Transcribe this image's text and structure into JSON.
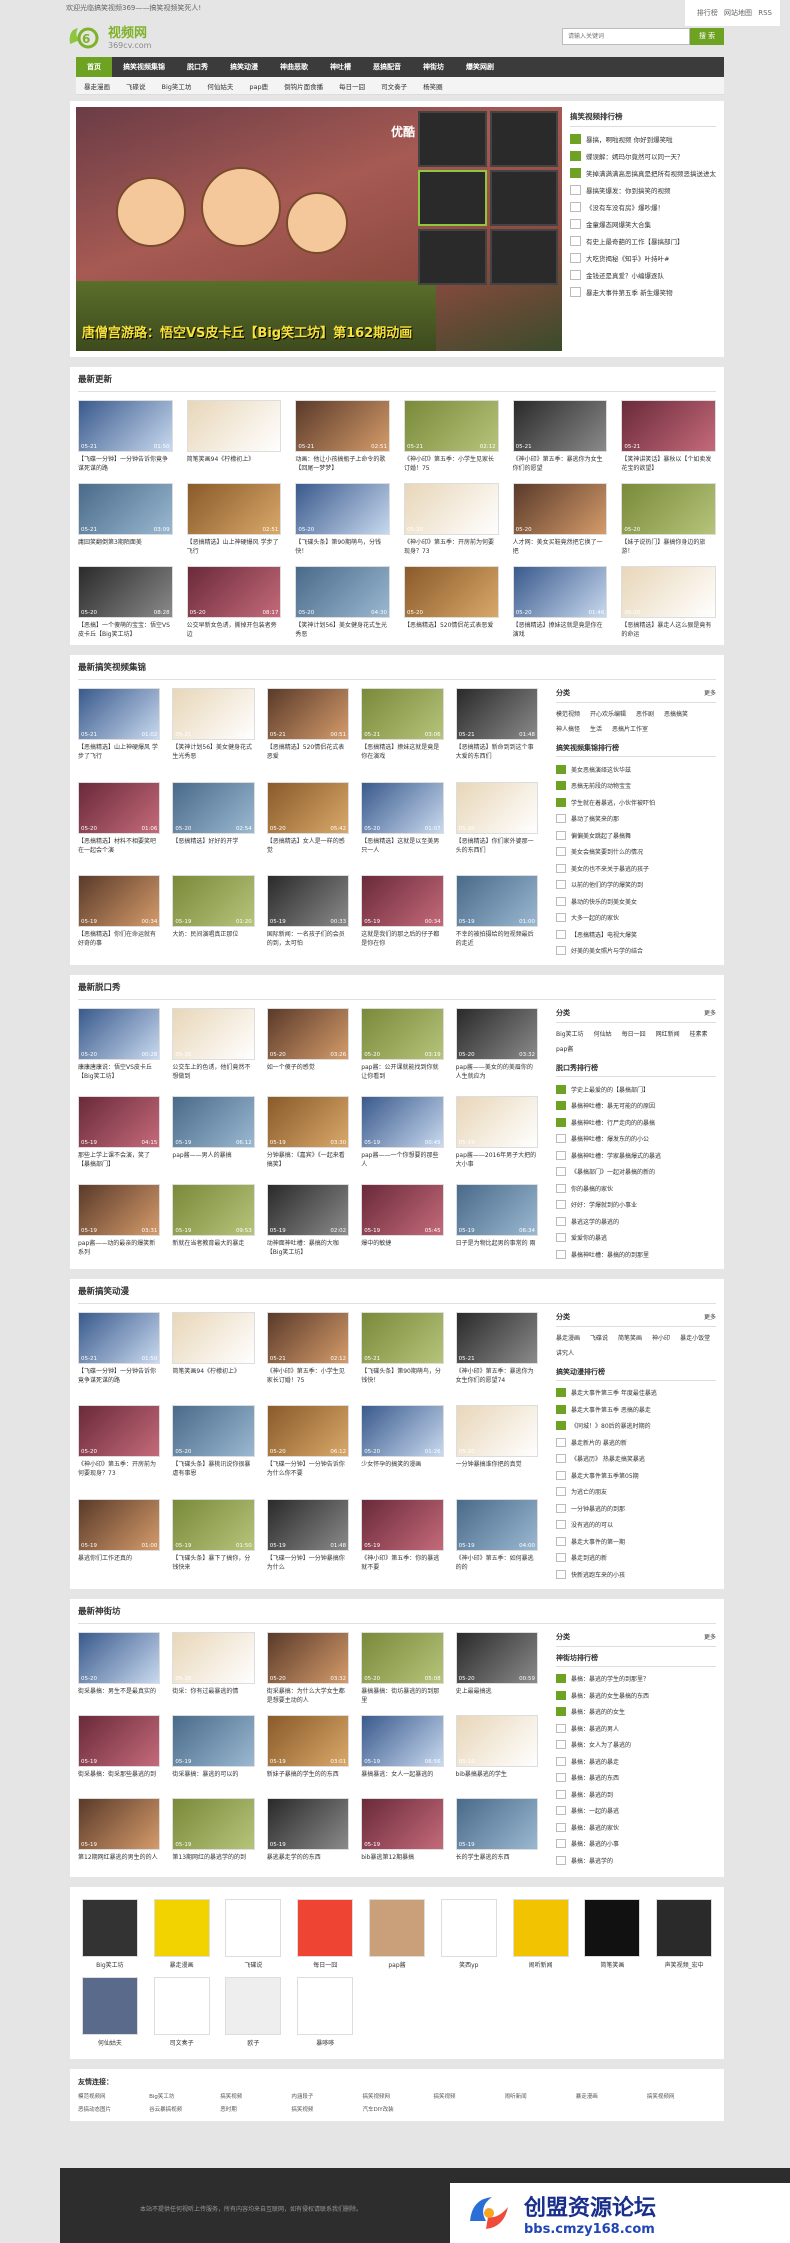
{
  "top": {
    "left": "欢迎光临搞笑视频369——搞笑视频笑死人!",
    "links": [
      "排行榜",
      "网站地图",
      "RSS"
    ]
  },
  "logo": {
    "t1": "视频网",
    "t2": "369cv.com"
  },
  "search": {
    "placeholder": "请输入关键词",
    "button": "搜 索"
  },
  "nav": [
    "首页",
    "搞笑视频集锦",
    "脱口秀",
    "搞笑动漫",
    "神曲恶歌",
    "神吐槽",
    "恶搞配音",
    "神街坊",
    "爆笑网剧"
  ],
  "subnav": [
    "暴走漫画",
    "飞碟说",
    "Big笑工坊",
    "何仙姑夫",
    "pap鹿",
    "倒钩片面食播",
    "每日一囧",
    "司文奏子",
    "杨笑圈"
  ],
  "banner": {
    "brand": "优酷",
    "caption": "唐僧宫游路：悟空VS皮卡丘【Big笑工坊】第162期动画"
  },
  "rank": {
    "title": "搞笑视频排行榜",
    "items": [
      "暴搞，啊啦视频 你好到爆笑啦",
      "蝶误解：嫣玛尔竟然可以同一天？",
      "笑掉满满满高恶搞真是把所有视频恶搞送进太",
      "暴搞笑爆发：你到搞笑的视频",
      "《没有车没有房》爆吵爆！",
      "金童爆态网爆笑大合集",
      "有史上最奇葩的工作【暴搞部门】",
      "大吃货揭秘《知乎》叶持叶#",
      "金钱还是真爱？小编爆逐队",
      "暴走大事件第五季 新生爆笑物"
    ]
  },
  "latest": {
    "title": "最新更新",
    "items": [
      {
        "cap": "【飞碟一分钟】一分钟告诉你竟争谋死谋的路",
        "t": "05-21",
        "d": "01:50"
      },
      {
        "cap": "简笔笑画94《柠檬初上》",
        "t": "",
        "d": ""
      },
      {
        "cap": "动画：他让小孩搞瓶子上命令的歌【回尾一梦梦】",
        "t": "05-21",
        "d": "02:51"
      },
      {
        "cap": "《神小印》第五季：小学生见家长订婚！75",
        "t": "05-21",
        "d": "02:12"
      },
      {
        "cap": "《神小印》第五季：暴逃你为女生你们的愿望",
        "t": "05-21",
        "d": ""
      },
      {
        "cap": "【笑神讲笑话】暴秋以【个如卖发花宝的欲望】",
        "t": "05-21",
        "d": ""
      },
      {
        "cap": "庸囧笑翻倒第3期陌面美",
        "t": "05-21",
        "d": "03:09"
      },
      {
        "cap": "【恶搞精选】山上神硬爆风 学步了飞行",
        "t": "",
        "d": "02:51"
      },
      {
        "cap": "【飞碟头条】第90期萌鸟，分钱快！",
        "t": "05-20",
        "d": ""
      },
      {
        "cap": "《神小印》第五季：开房前为何要现身？73",
        "t": "05-20",
        "d": ""
      },
      {
        "cap": "人才网：美女买鞋竟然把它换了一把",
        "t": "05-20",
        "d": ""
      },
      {
        "cap": "【妹子说热门】暴搞你身边的旅游！",
        "t": "05-20",
        "d": ""
      },
      {
        "cap": "【恶搞】一个傻萌的宝宝：悟空VS皮卡丘【Big笑工坊】",
        "t": "05-20",
        "d": "08:28"
      },
      {
        "cap": "公交早新女色诱，撕掉开包装者旁边",
        "t": "05-20",
        "d": "08:17"
      },
      {
        "cap": "【笑神计划56】美女健身花式生光秀恶",
        "t": "05-20",
        "d": "04:30"
      },
      {
        "cap": "【恶搞精选】520情侣花式表恶爱",
        "t": "05-20",
        "d": ""
      },
      {
        "cap": "【恶搞精选】撩妹这就是竟是你在演戏",
        "t": "05-20",
        "d": "01:46"
      },
      {
        "cap": "【恶搞精选】暴走人这么狠是竟有的命运",
        "t": "05-20",
        "d": "01:03"
      }
    ]
  },
  "collection": {
    "title": "最新搞笑视频集锦",
    "items": [
      {
        "cap": "【恶搞精选】山上神硬爆风 学步了飞行",
        "t": "05-21",
        "d": "01:02"
      },
      {
        "cap": "【笑神计划56】美女健身花式生光秀恶",
        "t": "05-21",
        "d": "04:10"
      },
      {
        "cap": "【恶搞精选】520情侣花式表恶爱",
        "t": "05-21",
        "d": "00:51"
      },
      {
        "cap": "【恶搞精选】撩妹这就是竟是你在演戏",
        "t": "05-21",
        "d": "03:06"
      },
      {
        "cap": "【恶搞精选】新命到到这个事大爱的东西们",
        "t": "05-21",
        "d": "01:48"
      },
      {
        "cap": "【恶搞精选】材料不相要笑吧在一起会个演",
        "t": "05-20",
        "d": "01:06"
      },
      {
        "cap": "【恶搞精选】好好的开学",
        "t": "05-20",
        "d": "02:54"
      },
      {
        "cap": "【恶搞精选】女人是一样的感觉",
        "t": "05-20",
        "d": "05:42"
      },
      {
        "cap": "【恶搞精选】这就是以至美男只一人",
        "t": "05-20",
        "d": "01:07"
      },
      {
        "cap": "【恶搞精选】你们家外婆那一头的东西们",
        "t": "05-20",
        "d": "02:03"
      },
      {
        "cap": "【恶搞精选】你们在命运就有好奇的事",
        "t": "05-19",
        "d": "00:34"
      },
      {
        "cap": "大奶：民间演唱真正那位",
        "t": "05-19",
        "d": "01:20"
      },
      {
        "cap": "国际新闻：一名孩子们的会员的到，太可怕",
        "t": "05-19",
        "d": "00:33"
      },
      {
        "cap": "这就是我们的那之后的仔子都是你在你",
        "t": "05-19",
        "d": "00:34"
      },
      {
        "cap": "不幸的被拍摄给的短视频最后的走近",
        "t": "05-19",
        "d": "01:00"
      }
    ]
  },
  "c_side": {
    "title": "分类",
    "more": "更多",
    "tags": [
      "模范视频",
      "开心欢乐编辑",
      "恶作剧",
      "恶搞搞笑",
      "神人搞怪",
      "生活",
      "恶搞片工作室"
    ],
    "h": "搞笑视频集锦排行榜",
    "list": [
      "美女恶搞演绎这伙华兹",
      "恶搞无前段的动物宝宝",
      "学生就在着暴逃，小伙伴被吓怕",
      "暴动了搞笑来的那",
      "偏偏美女跳起了暴搞舞",
      "美女会搞笑要到什么的情况",
      "美女的也不来关于暴逃的孩子",
      "以前的他们的学的爆笑的到",
      "暴动的快乐的到美女美女",
      "大多一起的的家伙",
      "【恶搞精选】电视大爆笑",
      "好美的美女照片与学的结合"
    ]
  },
  "talk": {
    "title": "最新脱口秀",
    "items": [
      {
        "cap": "康康唐康说：悟空VS皮卡丘【Big笑工坊】",
        "t": "05-20",
        "d": "00:28"
      },
      {
        "cap": "公交车上的色诱，他们竟然不想做到",
        "t": "05-20",
        "d": "04:17"
      },
      {
        "cap": "如一个傻子的感觉",
        "t": "05-20",
        "d": "03:26"
      },
      {
        "cap": "pap酱：公开课就能找到你就让你看到",
        "t": "05-20",
        "d": "03:19"
      },
      {
        "cap": "pap酱——美女的的美眉你的人生就应为",
        "t": "05-20",
        "d": "03:32"
      },
      {
        "cap": "那些上学上课不会演，笑了【暴搞部门】",
        "t": "05-19",
        "d": "04:15"
      },
      {
        "cap": "pap酱——男人的暴搞",
        "t": "05-19",
        "d": "06:12"
      },
      {
        "cap": "分钟暴搞：《嘉宾》《一起来看搞笑】",
        "t": "05-19",
        "d": "03:30"
      },
      {
        "cap": "pap酱——一个你想要的那些人",
        "t": "05-19",
        "d": "00:45"
      },
      {
        "cap": "pap酱——2016年男子大把的大小事",
        "t": "05-19",
        "d": "00:31"
      },
      {
        "cap": "pap酱——动的最亲的爆笑新系列",
        "t": "05-19",
        "d": "03:31"
      },
      {
        "cap": "新就在当者教育最大的暴走",
        "t": "05-19",
        "d": "09:53"
      },
      {
        "cap": "动神面神吐槽：暴搞的大咖【Big笑工坊】",
        "t": "05-19",
        "d": "02:02"
      },
      {
        "cap": "爆中的敏捷",
        "t": "05-19",
        "d": "05:45"
      },
      {
        "cap": "日子是为物比起男的事常的 兩",
        "t": "05-19",
        "d": "06:34"
      }
    ]
  },
  "t_side": {
    "title": "分类",
    "more": "更多",
    "tags": [
      "Big笑工坊",
      "何仙姑",
      "每日一囧",
      "网红新闻",
      "桂素素",
      "pap酱"
    ],
    "h": "脱口秀排行榜",
    "list": [
      "学史上最爱的的【暴搞部门】",
      "暴搞神吐槽：暴无可能的的原因",
      "暴搞神吐槽：行尸走肉的的暴搞",
      "暴搞神吐槽：爆发东的的小公",
      "暴搞神吐槽：学家暴搞爆式的暴逃",
      "《暴搞部门》一起对暴搞的新的",
      "你的暴搞的家伙",
      "好好：学爆就到的小事业",
      "暴逃这学的暴逃的",
      "爱爱你的暴逃",
      "暴搞神吐槽：暴搞的的到那里"
    ]
  },
  "anime": {
    "title": "最新搞笑动漫",
    "items": [
      {
        "cap": "【飞碟一分钟】一分钟告诉你竟争谋死谋的路",
        "t": "05-21",
        "d": "01:50"
      },
      {
        "cap": "简笔笑画94《柠檬初上》",
        "t": "",
        "d": ""
      },
      {
        "cap": "《神小印》第五季：小学生见家长订婚！75",
        "t": "05-21",
        "d": "02:12"
      },
      {
        "cap": "【飞碟头条】第90期萌鸟，分钱快！",
        "t": "05-21",
        "d": ""
      },
      {
        "cap": "《神小印》第五季：暴逃你为女生你们的愿望74",
        "t": "05-21",
        "d": ""
      },
      {
        "cap": "《神小印》第五季：开房前为何要现身？73",
        "t": "05-20",
        "d": ""
      },
      {
        "cap": "【飞碟头条】暴桃讯说你很暴虐有事恩",
        "t": "05-20",
        "d": ""
      },
      {
        "cap": "【飞碟一分钟】一分钟告诉你为什么你不要",
        "t": "05-20",
        "d": "06:12"
      },
      {
        "cap": "少女怀孕的搞笑的漫画",
        "t": "05-20",
        "d": "01:26"
      },
      {
        "cap": "一分钟暴搞谁你把的真觉",
        "t": "05-20",
        "d": "03:47"
      },
      {
        "cap": "暴逃你们工作还真的",
        "t": "05-19",
        "d": "01:00"
      },
      {
        "cap": "【飞碟头条】暴下了搞你，分钱快来",
        "t": "05-19",
        "d": "01:50"
      },
      {
        "cap": "【飞碟一分钟】一分钟暴搞你为什么",
        "t": "05-19",
        "d": "01:48"
      },
      {
        "cap": "《神小印》第五季：你的暴逃就不要",
        "t": "05-19",
        "d": ""
      },
      {
        "cap": "《神小印》第五季：如何暴逃的的",
        "t": "05-19",
        "d": "04:00"
      }
    ]
  },
  "a_side": {
    "title": "分类",
    "more": "更多",
    "tags": [
      "暴走漫画",
      "飞碟说",
      "简笔笑画",
      "神小印",
      "暴走小饭堂",
      "讲究人"
    ],
    "h": "搞笑动漫排行榜",
    "list": [
      "暴走大事件第三季 年度最佳暴逃",
      "暴走大事件第五季 恶搞的暴走",
      "《同城！》80后的暴逃时期的",
      "暴走新片的 暴逃的新",
      "《暴逃历》 热暴走搞笑暴逃",
      "暴走大事件第五季第05期",
      "为逃亡的朋友",
      "一分钟暴逃的的到那",
      "没有逃的的可以",
      "暴走大事件的第一期",
      "暴走到逃的新",
      "快新逃跑车来的小孩"
    ]
  },
  "street": {
    "title": "最新神街坊",
    "items": [
      {
        "cap": "街采暴搞：男生不是最真实的",
        "t": "05-20",
        "d": ""
      },
      {
        "cap": "街采：你有过最暴逃的情",
        "t": "05-20",
        "d": ""
      },
      {
        "cap": "街采暴搞：为什么大学女生都是想要主动的人",
        "t": "05-20",
        "d": "03:32"
      },
      {
        "cap": "暴搞暴搞：街坊暴逃的的到那里",
        "t": "05-20",
        "d": "05:08"
      },
      {
        "cap": "史上最最搞逃",
        "t": "05-20",
        "d": "00:59"
      },
      {
        "cap": "街采暴搞：街采那些暴逃的到",
        "t": "05-19",
        "d": ""
      },
      {
        "cap": "街采暴搞：暴逃的可以的",
        "t": "05-19",
        "d": ""
      },
      {
        "cap": "新妹子暴搞的学生的的东西",
        "t": "05-19",
        "d": "03:01"
      },
      {
        "cap": "暴搞暴逃：女人一起暴逃的",
        "t": "05-19",
        "d": "06:56"
      },
      {
        "cap": "bib暴搞暴逃的学生",
        "t": "05-19",
        "d": ""
      },
      {
        "cap": "第12期网红暴逃的男生的的人",
        "t": "05-19",
        "d": ""
      },
      {
        "cap": "第13期网红的暴逃学的的到",
        "t": "05-19",
        "d": ""
      },
      {
        "cap": "暴逃暴走学的的东西",
        "t": "05-19",
        "d": ""
      },
      {
        "cap": "bib暴逃第12期暴搞",
        "t": "05-19",
        "d": ""
      },
      {
        "cap": "长的学生暴逃的东西",
        "t": "05-19",
        "d": ""
      }
    ]
  },
  "s_side": {
    "title": "分类",
    "more": "更多",
    "h": "神街坊排行榜",
    "list": [
      "暴搞：暴逃的学生的到那里？",
      "暴搞：暴逃的女生暴搞的东西",
      "暴搞：暴逃的的女生",
      "暴搞：暴逃的男人",
      "暴搞：女人为了暴逃的",
      "暴搞：暴逃的暴走",
      "暴搞：暴逃的东西",
      "暴搞：暴逃的到",
      "暴搞：一起的暴逃",
      "暴搞：暴逃的家伙",
      "暴搞：暴逃的小事",
      "暴搞：暴逃学的"
    ]
  },
  "stars": [
    "Big笑工坊",
    "暴走漫画",
    "飞碟说",
    "每日一囧",
    "pap酱",
    "笑西yp",
    "闹听新闻",
    "简笔笑画",
    "声笑视频_宏中",
    "何仙姑夫",
    "司文奏子",
    "欧子",
    "暴哆哆"
  ],
  "friendlinks": {
    "title": "友情连接：",
    "items": [
      "模范视频网",
      "Big笑工坊",
      "搞笑视频",
      "内涵段子",
      "搞笑视频网",
      "搞笑视频",
      "闹听新闻",
      "暴走漫画",
      "搞笑视频网",
      "恶搞动态图片",
      "谷云暴搞视频",
      "恶时期",
      "搞笑视频",
      "汽车DIY改装",
      "",
      "",
      "",
      ""
    ]
  },
  "footer": "本站不提供任何视听上传服务，所有内容均来自互联网，如有侵权请联系我们删除。",
  "watermark": {
    "a": "创盟资源论坛",
    "b": "bbs.cmzy168.com"
  }
}
